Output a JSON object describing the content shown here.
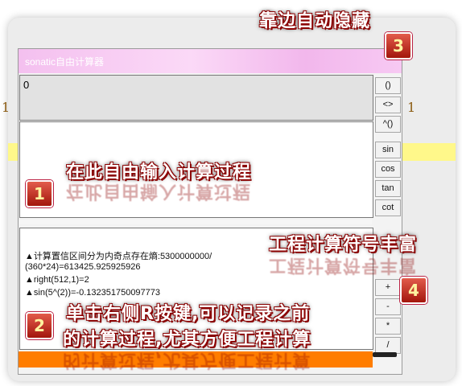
{
  "background": {
    "fragment_left": "1",
    "fragment_right": "1"
  },
  "window": {
    "title": "sonatic自由计算器"
  },
  "display": {
    "value": "0"
  },
  "history": {
    "lines": [
      "▲计算置信区间分为内奇点存在熵:5300000000/",
      "(360*24)=613425.925925926",
      "▲right(512,1)=2",
      "▲sin(5^(2))=-0.132351750097773"
    ]
  },
  "buttons": {
    "top": [
      "()",
      "<>",
      "^()",
      "sin",
      "cos",
      "tan",
      "cot"
    ],
    "bottom": [
      "+",
      "-",
      "*",
      "/"
    ]
  },
  "annotations": {
    "auto_hide": "靠边自动隐藏",
    "free_input": "在此自由输入计算过程",
    "symbols": "工程计算符号丰富",
    "record_line1": "单击右侧R按键,可以记录之前",
    "record_line2": "的计算过程,尤其方便工程计算"
  },
  "badges": {
    "b1": "1",
    "b2": "2",
    "b3": "3",
    "b4": "4"
  },
  "colors": {
    "status_bar": "#ff7d00",
    "highlight_bar": "#fff88a",
    "title_gradient": "#f4c0ef",
    "badge": "#c0392b"
  }
}
